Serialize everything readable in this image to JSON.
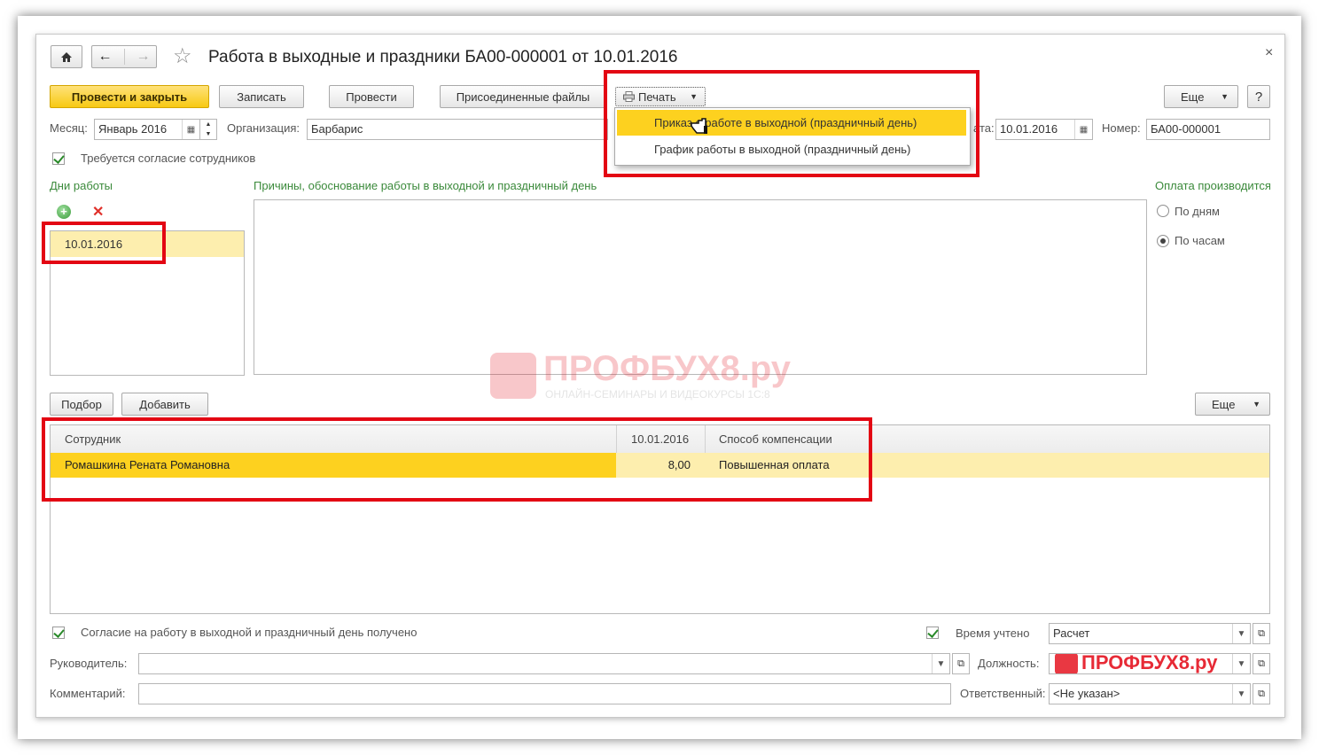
{
  "title": "Работа в выходные и праздники БА00-000001 от 10.01.2016",
  "toolbar": {
    "post_close": "Провести и закрыть",
    "save": "Записать",
    "post": "Провести",
    "attached": "Присоединенные файлы",
    "print": "Печать",
    "more": "Еще",
    "help": "?"
  },
  "print_menu": [
    "Приказ о работе в выходной (праздничный день)",
    "График работы в выходной (праздничный день)"
  ],
  "fields": {
    "month_label": "Месяц:",
    "month_value": "Январь 2016",
    "org_label": "Организация:",
    "org_value": "Барбарис",
    "date_label": "ата:",
    "date_value": "10.01.2016",
    "number_label": "Номер:",
    "number_value": "БА00-000001"
  },
  "consent_required": "Требуется согласие сотрудников",
  "days_section": "Дни работы",
  "days": [
    "10.01.2016"
  ],
  "reasons_label": "Причины, обоснование работы в выходной и праздничный день",
  "payment": {
    "title": "Оплата производится",
    "by_days": "По дням",
    "by_hours": "По часам"
  },
  "table_toolbar": {
    "pick": "Подбор",
    "add": "Добавить",
    "more": "Еще"
  },
  "table": {
    "columns": [
      "Сотрудник",
      "10.01.2016",
      "Способ компенсации"
    ],
    "rows": [
      {
        "employee": "Ромашкина Рената Романовна",
        "hours": "8,00",
        "compensation": "Повышенная оплата"
      }
    ]
  },
  "bottom": {
    "consent_received": "Согласие на работу в выходной и праздничный день получено",
    "time_counted": "Время учтено",
    "time_value": "Расчет",
    "manager_label": "Руководитель:",
    "position_label": "Должность:",
    "comment_label": "Комментарий:",
    "responsible_label": "Ответственный:",
    "responsible_value": "<Не указан>"
  },
  "watermark": {
    "brand": "ПРОФБУХ8.ру",
    "tagline": "ОНЛАЙН-СЕМИНАРЫ И ВИДЕОКУРСЫ 1С:8"
  },
  "colors": {
    "accent_yellow": "#f7c913",
    "selected_row": "#fdd11f",
    "selected_light": "#fdeeae",
    "highlight_red": "#e30613",
    "section_green": "#3b8a3b"
  }
}
